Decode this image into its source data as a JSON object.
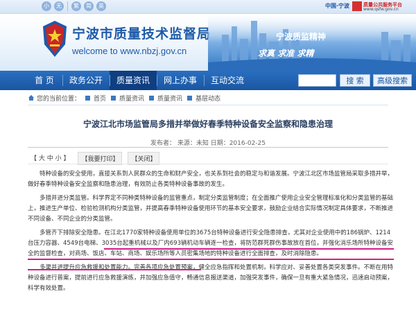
{
  "topbar": {
    "util_icons": [
      "小",
      "无",
      "繁",
      "简",
      "英"
    ],
    "china_label": "中国·宁波",
    "qsfw_name": "质量公共服务平台",
    "qsfw_url": "www.qsfw.gov.cn"
  },
  "header": {
    "title": "宁波市质量技术监督局",
    "url": "welcome to www.nbzj.gov.cn",
    "spirit": "宁波质监精神",
    "slogan": "求真 求准 求精"
  },
  "nav": {
    "items": [
      "首  页",
      "政务公开",
      "质量资讯",
      "网上办事",
      "互动交流"
    ],
    "active_index": 2,
    "search_button": "搜  索",
    "advanced_button": "高级搜索",
    "search_placeholder": ""
  },
  "breadcrumb": {
    "prefix": "您的当前位置：",
    "items": [
      "首页",
      "质量资讯",
      "质量资讯",
      "基层动态"
    ]
  },
  "article": {
    "title": "宁波江北市场监管局多措并举做好春季特种设备安全监察和隐患治理",
    "meta": "发布者：  来源：未知   日期：2016-02-25",
    "toolbar": {
      "size_label": "【 大  中  小 】",
      "print": "【我要打印】",
      "close": "【关闭】"
    },
    "paragraphs": [
      "特种设备的安全使用，直接关系到人民群众的生命和财产安全，也关系到社会的稳定与和谐发展。宁波江北区市场监管局采取多措并举，做好春季特种设备安全监察和隐患治理，有效防止各类特种设备事故的发生。",
      "多措并进分类监管。科学界定不同种类特种设备的监管重点，制定分类监管制度；在全面推广使用企业安全管理标准化和分类监管的基础上，推进生产单位、检验检测机构分类监管，并提高春季特种设备使用环节的基本安全要求，鼓励企业结合实际情况制定具体要求，不断推进不同设备、不同企业的分类监管。",
      "多管齐下排除安全隐患。在江北1770家特种设备使用单位的3675台特种设备进行安全隐患排查，尤其对企业使用中的186锅炉、1214台压力容器、4549台电梯、3035台起重机械以及厂内693辆机动车辆逐一检查，将防范群死群伤事故放在首位，并强化消乐场所特种设备安全的监督检查，对商场、饭店、车站、商场、娱乐场所等人员密集场地的特种设备进行全面排查，及时消除隐患。",
      "多渠并进提升应急救援和处置能力。完善各项应急处置预案，健全应急指挥和处置机制，科学应对、妥善处置各类突发事件。不断在用特种设备进行普案，提前进行应急救援演练，并加强应急值守，畅通信息报送渠道，加强突发事件，确保一旦有重大紧急情况，迅速启动预案，科学有效处置。"
    ]
  }
}
